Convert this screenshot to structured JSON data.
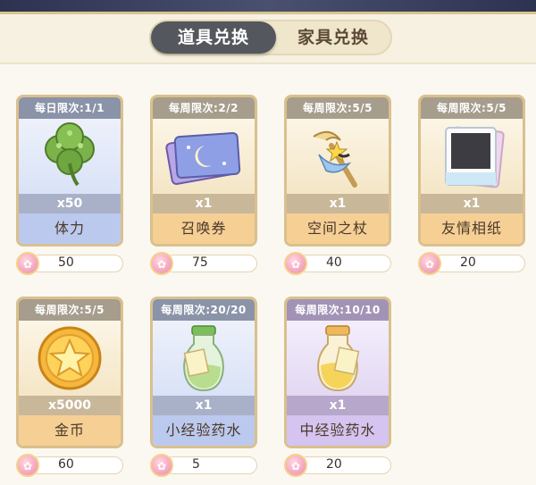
{
  "tabs": [
    {
      "label": "道具兑换",
      "active": true
    },
    {
      "label": "家具兑换",
      "active": false
    }
  ],
  "currency_icon": "flower-coin-icon",
  "items": [
    {
      "limit": "每日限次:1/1",
      "qty": "x50",
      "name": "体力",
      "price": "50",
      "icon": "clover-icon",
      "theme": "blue"
    },
    {
      "limit": "每周限次:2/2",
      "qty": "x1",
      "name": "召唤券",
      "price": "75",
      "icon": "summon-ticket-icon",
      "theme": "gold"
    },
    {
      "limit": "每周限次:5/5",
      "qty": "x1",
      "name": "空间之杖",
      "price": "40",
      "icon": "space-staff-icon",
      "theme": "gold"
    },
    {
      "limit": "每周限次:5/5",
      "qty": "x1",
      "name": "友情相纸",
      "price": "20",
      "icon": "photo-paper-icon",
      "theme": "gold"
    },
    {
      "limit": "每周限次:5/5",
      "qty": "x5000",
      "name": "金币",
      "price": "60",
      "icon": "gold-coin-icon",
      "theme": "gold"
    },
    {
      "limit": "每周限次:20/20",
      "qty": "x1",
      "name": "小经验药水",
      "price": "5",
      "icon": "small-exp-potion-icon",
      "theme": "blue"
    },
    {
      "limit": "每周限次:10/10",
      "qty": "x1",
      "name": "中经验药水",
      "price": "20",
      "icon": "medium-exp-potion-icon",
      "theme": "purple"
    }
  ]
}
